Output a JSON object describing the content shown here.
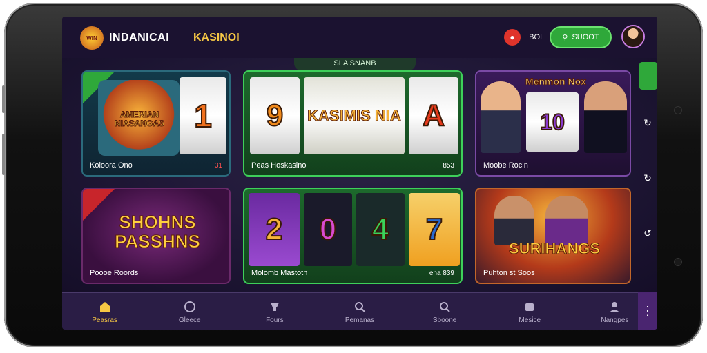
{
  "topbar": {
    "logo_text": "WIN",
    "brand": "INDANICAI",
    "brand_sub": "KASINOI",
    "pin_label": "  BOI",
    "search_label": "SUOOT"
  },
  "section_tab": "SLA SNANB",
  "cards": [
    {
      "title": "AMERIAN NIASANGAS",
      "caption": "Koloora Ono",
      "count": "31"
    },
    {
      "title": "KASIMIS NIA",
      "caption": "Peas Hoskasino",
      "count": "853",
      "reels": [
        "9",
        "",
        "A"
      ]
    },
    {
      "title": "Menmon Nox",
      "caption": "Moobe Rocin",
      "count": "",
      "reel": "10"
    },
    {
      "title": "SHOHNS PASSHNS",
      "caption": "Poooe Roords",
      "count": ""
    },
    {
      "title": "",
      "caption": "Molomb Mastotn",
      "count": "ena 839",
      "reels": [
        "2",
        "0",
        "4",
        "7"
      ]
    },
    {
      "title": "SURIHANGS",
      "caption": "Puhton st Soos",
      "count": ""
    }
  ],
  "bottom_nav": [
    {
      "label": "Peasras",
      "icon": "home-icon"
    },
    {
      "label": "Gleece",
      "icon": "globe-icon"
    },
    {
      "label": "Fours",
      "icon": "trophy-icon"
    },
    {
      "label": "Pemanas",
      "icon": "search-icon"
    },
    {
      "label": "Sboone",
      "icon": "search-icon"
    },
    {
      "label": "Mesice",
      "icon": "chip-icon"
    },
    {
      "label": "Nangpes",
      "icon": "user-icon"
    }
  ],
  "colors": {
    "accent_green": "#2fa83a",
    "accent_yellow": "#f6c744",
    "bg": "#1b1230"
  }
}
